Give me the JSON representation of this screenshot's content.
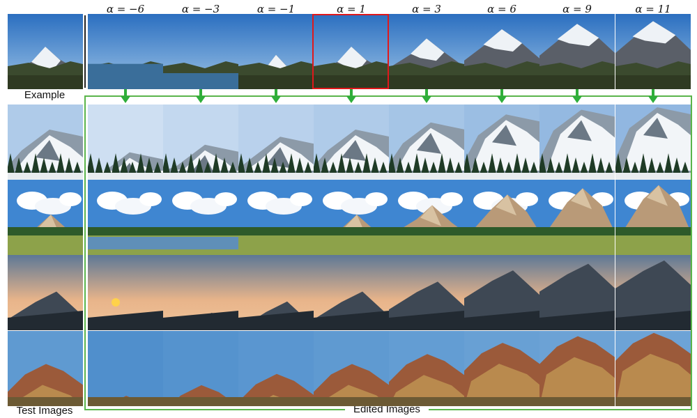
{
  "figure": {
    "alphas": [
      "α = −6",
      "α = −3",
      "α = −1",
      "α = 1",
      "α = 3",
      "α = 6",
      "α = 9",
      "α = 11"
    ],
    "selected_alpha_index": 3,
    "labels": {
      "example": "Example",
      "test_images": "Test Images",
      "edited_images": "Edited Images"
    },
    "colors": {
      "frame": "#5ab54b",
      "highlight": "#e0181b",
      "arrow": "#2fae3a"
    },
    "rows": [
      {
        "scene": "snow-mountain-peak"
      },
      {
        "scene": "snowy-mountain-forest"
      },
      {
        "scene": "meadow-clouds"
      },
      {
        "scene": "sunset-hills"
      },
      {
        "scene": "red-rock-desert"
      }
    ]
  }
}
